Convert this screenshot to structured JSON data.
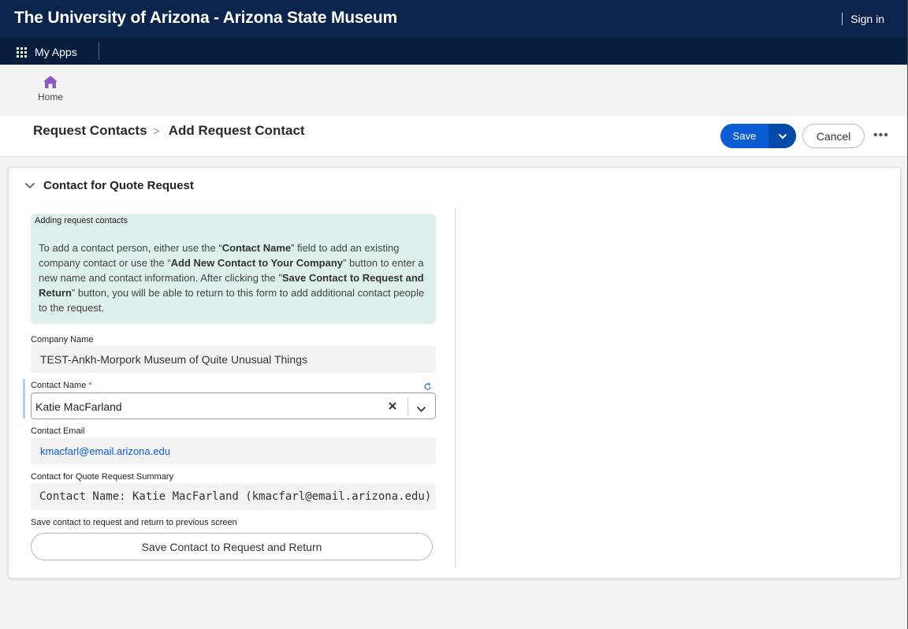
{
  "topbar": {
    "title": "The University of Arizona - Arizona State Museum",
    "signin": "Sign in",
    "bg_color": "#0c234b"
  },
  "appbar": {
    "apps_label": "My Apps",
    "apps_icon": "waffle-grid-icon"
  },
  "nav": {
    "home_label": "Home",
    "home_icon": "home-icon",
    "home_icon_color": "#8a5cc2"
  },
  "header": {
    "breadcrumb_parent": "Request Contacts",
    "breadcrumb_current": "Add Request Contact",
    "save_label": "Save",
    "cancel_label": "Cancel",
    "more_label": "•••",
    "accent_color": "#0b5cd5"
  },
  "section": {
    "title": "Contact for Quote Request",
    "info_title": "Adding request contacts",
    "info_text": {
      "p1": "To add a contact person, either use the “",
      "b1": "Contact Name",
      "p2": "” field to add an existing company contact or use the “",
      "b2": "Add New Contact to Your Company",
      "p3": "” button to enter a new name and contact information. After clicking the \"",
      "b3": "Save Contact to Request and Return",
      "p4": "” button, you will be able to return to this form to add additional contact people to the request."
    },
    "info_bg": "#def0ee"
  },
  "fields": {
    "company_label": "Company Name",
    "company_value": "TEST-Ankh-Morpork Museum of Quite Unusual Things",
    "contact_label": "Contact Name",
    "required_mark": "*",
    "contact_value": "Katie MacFarland",
    "email_label": "Contact Email",
    "email_value": "kmacfarl@email.arizona.edu",
    "summary_label": "Contact for Quote Request Summary",
    "summary_value": "Contact Name: Katie MacFarland (kmacfarl@email.arizona.edu)",
    "save_return_label": "Save contact to request and return to previous screen",
    "save_return_button": "Save Contact to Request and Return"
  }
}
